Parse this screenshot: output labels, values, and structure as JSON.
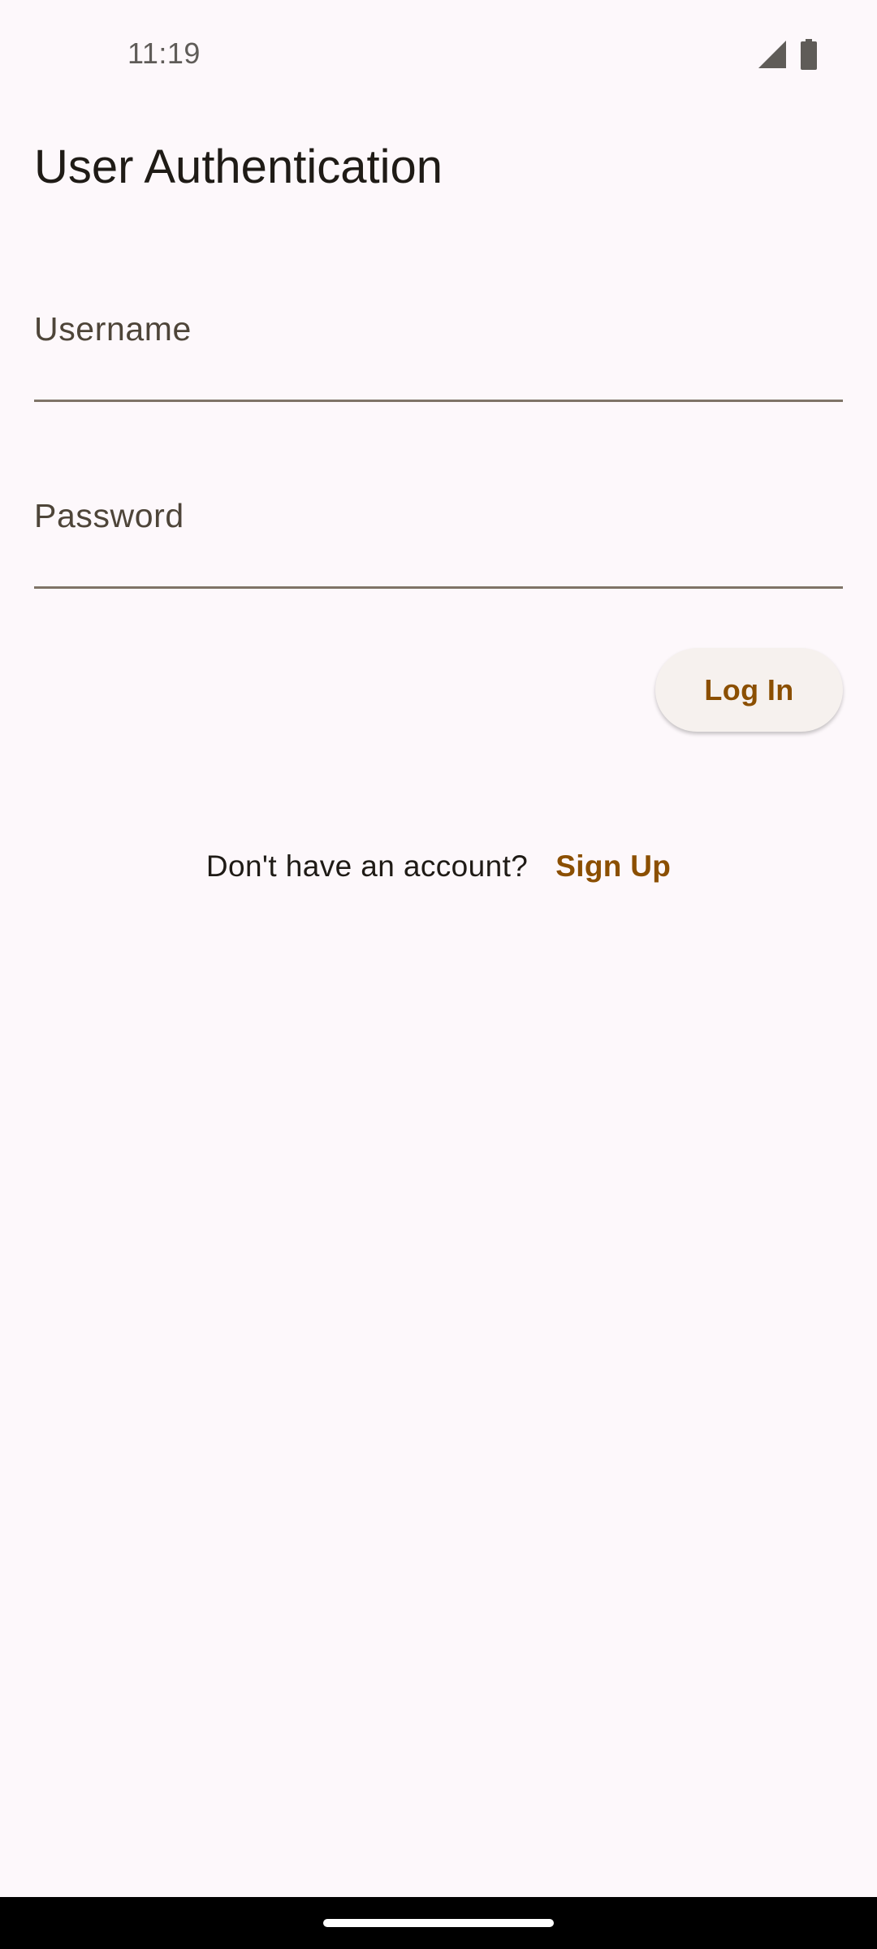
{
  "status_bar": {
    "time": "11:19",
    "icons": [
      "cellular-signal-icon",
      "battery-icon"
    ]
  },
  "header": {
    "title": "User Authentication"
  },
  "form": {
    "username_label": "Username",
    "username_value": "",
    "password_label": "Password",
    "password_value": "",
    "login_label": "Log In"
  },
  "signup": {
    "prompt": "Don't have an account?",
    "link_label": "Sign Up"
  },
  "colors": {
    "background": "#fdf8fb",
    "accent": "#8b4f00",
    "text": "#1f1b16",
    "field_underline": "#7f7467"
  }
}
